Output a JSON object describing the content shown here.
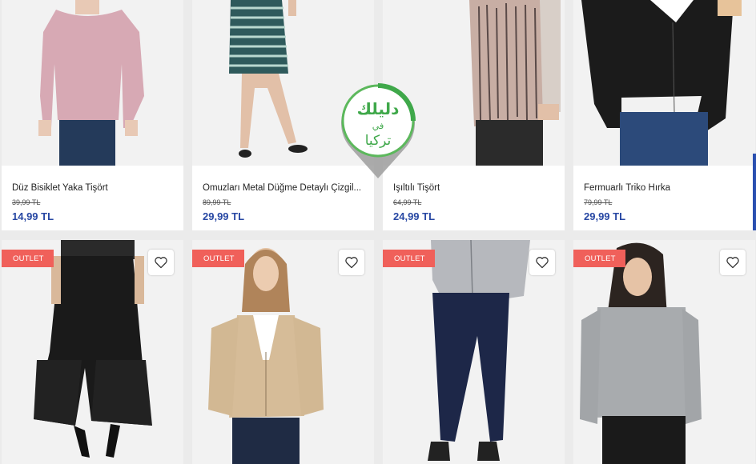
{
  "row1": [
    {
      "name": "Düz Bisiklet Yaka Tişört",
      "old_price": "39,99 TL",
      "price": "14,99 TL"
    },
    {
      "name": "Omuzları Metal Düğme Detaylı Çizgil...",
      "old_price": "89,99 TL",
      "price": "29,99 TL"
    },
    {
      "name": "Işıltılı Tişört",
      "old_price": "64,99 TL",
      "price": "24,99 TL"
    },
    {
      "name": "Fermuarlı Triko Hırka",
      "old_price": "79,99 TL",
      "price": "29,99 TL"
    }
  ],
  "row2": [
    {
      "badge": "OUTLET"
    },
    {
      "badge": "OUTLET"
    },
    {
      "badge": "OUTLET"
    },
    {
      "badge": "OUTLET"
    }
  ],
  "watermark": {
    "line1": "دليلك",
    "line2": "في",
    "line3": "تركيا",
    "color": "#3fa84a"
  },
  "colors": {
    "price": "#2747a3",
    "badge": "#f0605a"
  },
  "icons": {
    "favorite": "heart-outline-icon"
  }
}
